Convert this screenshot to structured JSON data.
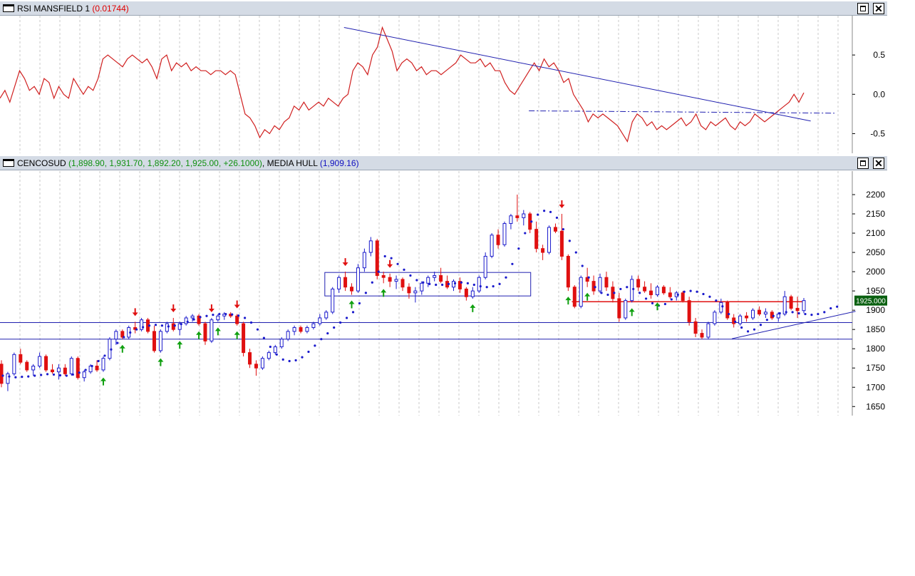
{
  "rsi_pane": {
    "title": "RSI MANSFIELD 1",
    "value": "(0.01744)"
  },
  "price_pane": {
    "symbol": "CENCOSUD",
    "ohlc": "(1,898.90, 1,931.70, 1,892.20, 1,925.00, +26.1000)",
    "indicator": "MEDIA HULL",
    "indicator_value": "(1,909.16)",
    "last_price_tag": "1925.000"
  },
  "colors": {
    "up": "#1a1acc",
    "down": "#e01010",
    "rsi_line": "#d02020",
    "trendline": "#2020b0",
    "grid": "#c8c8c8",
    "buy_arrow": "#10a010",
    "sell_arrow": "#e01010"
  },
  "icons": [
    "window-icon",
    "maximize-icon",
    "close-icon",
    "up-arrow-icon",
    "down-arrow-icon"
  ],
  "chart_data": [
    {
      "type": "line",
      "title": "RSI MANSFIELD 1",
      "ylim": [
        -0.75,
        1.0
      ],
      "yticks": [
        "0.5",
        "0.0",
        "-0.5"
      ],
      "grid": "vertical dashed",
      "series": [
        {
          "name": "RSI MANSFIELD 1",
          "values": [
            -0.05,
            0.05,
            -0.1,
            0.1,
            0.3,
            0.2,
            0.05,
            0.1,
            0.0,
            0.2,
            0.15,
            -0.05,
            0.1,
            0.0,
            -0.05,
            0.2,
            0.1,
            0.0,
            0.1,
            0.05,
            0.2,
            0.45,
            0.5,
            0.45,
            0.4,
            0.35,
            0.45,
            0.5,
            0.45,
            0.4,
            0.45,
            0.35,
            0.2,
            0.45,
            0.5,
            0.3,
            0.4,
            0.35,
            0.4,
            0.3,
            0.35,
            0.3,
            0.3,
            0.25,
            0.3,
            0.3,
            0.25,
            0.3,
            0.25,
            0.0,
            -0.25,
            -0.3,
            -0.4,
            -0.55,
            -0.45,
            -0.5,
            -0.4,
            -0.45,
            -0.35,
            -0.3,
            -0.15,
            -0.2,
            -0.1,
            -0.2,
            -0.15,
            -0.1,
            -0.15,
            -0.05,
            -0.1,
            -0.15,
            -0.05,
            0.0,
            0.3,
            0.4,
            0.35,
            0.25,
            0.5,
            0.6,
            0.85,
            0.7,
            0.55,
            0.3,
            0.4,
            0.45,
            0.4,
            0.3,
            0.35,
            0.25,
            0.3,
            0.3,
            0.25,
            0.3,
            0.35,
            0.4,
            0.5,
            0.45,
            0.4,
            0.4,
            0.45,
            0.35,
            0.4,
            0.3,
            0.3,
            0.15,
            0.05,
            0.0,
            0.1,
            0.2,
            0.3,
            0.4,
            0.3,
            0.45,
            0.35,
            0.4,
            0.3,
            0.15,
            0.2,
            0.0,
            -0.1,
            -0.2,
            -0.35,
            -0.25,
            -0.3,
            -0.25,
            -0.3,
            -0.35,
            -0.4,
            -0.5,
            -0.6,
            -0.35,
            -0.25,
            -0.3,
            -0.4,
            -0.35,
            -0.45,
            -0.4,
            -0.45,
            -0.4,
            -0.35,
            -0.3,
            -0.4,
            -0.35,
            -0.25,
            -0.4,
            -0.45,
            -0.35,
            -0.4,
            -0.35,
            -0.3,
            -0.4,
            -0.45,
            -0.35,
            -0.4,
            -0.35,
            -0.25,
            -0.3,
            -0.35,
            -0.3,
            -0.25,
            -0.2,
            -0.15,
            -0.1,
            0.0,
            -0.1,
            0.02
          ]
        }
      ],
      "trendlines": [
        {
          "style": "solid",
          "from": [
            0.376,
            0.85
          ],
          "to": [
            0.886,
            -0.34
          ]
        },
        {
          "style": "dashdot",
          "from": [
            0.578,
            -0.21
          ],
          "to": [
            0.912,
            -0.24
          ]
        }
      ]
    },
    {
      "type": "candlestick",
      "title": "CENCOSUD",
      "ylim": [
        1650,
        2220
      ],
      "yticks": [
        "2200",
        "2150",
        "2100",
        "2050",
        "2000",
        "1950",
        "1900",
        "1850",
        "1800",
        "1750",
        "1700",
        "1650"
      ],
      "grid": "vertical dashed",
      "candles": [
        [
          1760,
          1770,
          1700,
          1710
        ],
        [
          1710,
          1740,
          1690,
          1735
        ],
        [
          1735,
          1790,
          1730,
          1785
        ],
        [
          1785,
          1800,
          1760,
          1765
        ],
        [
          1765,
          1770,
          1740,
          1745
        ],
        [
          1745,
          1760,
          1730,
          1755
        ],
        [
          1755,
          1790,
          1750,
          1780
        ],
        [
          1780,
          1785,
          1740,
          1745
        ],
        [
          1745,
          1760,
          1735,
          1740
        ],
        [
          1740,
          1760,
          1720,
          1750
        ],
        [
          1750,
          1760,
          1730,
          1735
        ],
        [
          1735,
          1780,
          1730,
          1775
        ],
        [
          1775,
          1780,
          1720,
          1725
        ],
        [
          1725,
          1745,
          1715,
          1740
        ],
        [
          1740,
          1760,
          1735,
          1755
        ],
        [
          1755,
          1770,
          1740,
          1745
        ],
        [
          1745,
          1780,
          1740,
          1775
        ],
        [
          1775,
          1830,
          1770,
          1825
        ],
        [
          1825,
          1850,
          1810,
          1845
        ],
        [
          1845,
          1850,
          1825,
          1830
        ],
        [
          1830,
          1860,
          1825,
          1855
        ],
        [
          1855,
          1870,
          1840,
          1850
        ],
        [
          1850,
          1880,
          1845,
          1875
        ],
        [
          1875,
          1880,
          1840,
          1845
        ],
        [
          1845,
          1860,
          1790,
          1795
        ],
        [
          1795,
          1850,
          1790,
          1845
        ],
        [
          1845,
          1870,
          1840,
          1865
        ],
        [
          1865,
          1880,
          1845,
          1850
        ],
        [
          1850,
          1870,
          1835,
          1865
        ],
        [
          1865,
          1885,
          1860,
          1880
        ],
        [
          1880,
          1890,
          1870,
          1885
        ],
        [
          1885,
          1890,
          1860,
          1865
        ],
        [
          1865,
          1870,
          1810,
          1820
        ],
        [
          1820,
          1880,
          1815,
          1875
        ],
        [
          1875,
          1890,
          1870,
          1885
        ],
        [
          1885,
          1895,
          1875,
          1890
        ],
        [
          1890,
          1895,
          1880,
          1885
        ],
        [
          1885,
          1890,
          1860,
          1865
        ],
        [
          1865,
          1870,
          1780,
          1790
        ],
        [
          1790,
          1800,
          1750,
          1760
        ],
        [
          1760,
          1770,
          1730,
          1750
        ],
        [
          1750,
          1780,
          1745,
          1775
        ],
        [
          1775,
          1795,
          1770,
          1790
        ],
        [
          1790,
          1810,
          1785,
          1805
        ],
        [
          1805,
          1830,
          1800,
          1825
        ],
        [
          1825,
          1850,
          1820,
          1845
        ],
        [
          1845,
          1860,
          1835,
          1855
        ],
        [
          1855,
          1860,
          1840,
          1845
        ],
        [
          1845,
          1860,
          1840,
          1855
        ],
        [
          1855,
          1870,
          1850,
          1865
        ],
        [
          1865,
          1890,
          1860,
          1880
        ],
        [
          1880,
          1900,
          1875,
          1895
        ],
        [
          1895,
          1960,
          1890,
          1955
        ],
        [
          1955,
          1990,
          1945,
          1985
        ],
        [
          1985,
          2000,
          1950,
          1960
        ],
        [
          1960,
          1970,
          1940,
          1950
        ],
        [
          1950,
          2020,
          1945,
          2010
        ],
        [
          2010,
          2060,
          2000,
          2050
        ],
        [
          2050,
          2090,
          2040,
          2080
        ],
        [
          2080,
          2085,
          1980,
          1990
        ],
        [
          1990,
          2000,
          1970,
          1985
        ],
        [
          1985,
          1995,
          1960,
          1975
        ],
        [
          1975,
          1990,
          1955,
          1980
        ],
        [
          1980,
          1985,
          1950,
          1960
        ],
        [
          1960,
          1970,
          1930,
          1945
        ],
        [
          1945,
          1960,
          1920,
          1950
        ],
        [
          1950,
          1975,
          1940,
          1970
        ],
        [
          1970,
          1990,
          1960,
          1985
        ],
        [
          1985,
          2000,
          1975,
          1990
        ],
        [
          1990,
          2010,
          1970,
          1975
        ],
        [
          1975,
          1990,
          1955,
          1960
        ],
        [
          1960,
          1980,
          1950,
          1975
        ],
        [
          1975,
          1985,
          1945,
          1955
        ],
        [
          1955,
          1960,
          1925,
          1935
        ],
        [
          1935,
          1960,
          1930,
          1950
        ],
        [
          1950,
          1990,
          1945,
          1985
        ],
        [
          1985,
          2050,
          1980,
          2040
        ],
        [
          2040,
          2100,
          2035,
          2095
        ],
        [
          2095,
          2110,
          2060,
          2070
        ],
        [
          2070,
          2130,
          2065,
          2125
        ],
        [
          2125,
          2150,
          2110,
          2145
        ],
        [
          2145,
          2200,
          2130,
          2140
        ],
        [
          2140,
          2160,
          2120,
          2150
        ],
        [
          2150,
          2155,
          2100,
          2110
        ],
        [
          2110,
          2130,
          2050,
          2060
        ],
        [
          2060,
          2070,
          2030,
          2050
        ],
        [
          2050,
          2120,
          2045,
          2115
        ],
        [
          2115,
          2125,
          2100,
          2105
        ],
        [
          2105,
          2150,
          2030,
          2040
        ],
        [
          2040,
          2045,
          1950,
          1960
        ],
        [
          1960,
          1965,
          1905,
          1910
        ],
        [
          1910,
          1990,
          1905,
          1985
        ],
        [
          1985,
          2010,
          1960,
          1975
        ],
        [
          1975,
          1990,
          1940,
          1950
        ],
        [
          1950,
          1995,
          1945,
          1985
        ],
        [
          1985,
          2000,
          1950,
          1960
        ],
        [
          1960,
          1975,
          1920,
          1930
        ],
        [
          1930,
          1945,
          1870,
          1880
        ],
        [
          1880,
          1930,
          1875,
          1925
        ],
        [
          1925,
          1990,
          1920,
          1980
        ],
        [
          1980,
          1990,
          1950,
          1960
        ],
        [
          1960,
          1975,
          1945,
          1950
        ],
        [
          1950,
          1970,
          1930,
          1940
        ],
        [
          1940,
          1965,
          1935,
          1960
        ],
        [
          1960,
          1965,
          1940,
          1945
        ],
        [
          1945,
          1960,
          1930,
          1935
        ],
        [
          1935,
          1950,
          1925,
          1945
        ],
        [
          1945,
          1950,
          1920,
          1925
        ],
        [
          1925,
          1935,
          1860,
          1870
        ],
        [
          1870,
          1880,
          1830,
          1840
        ],
        [
          1840,
          1850,
          1825,
          1830
        ],
        [
          1830,
          1870,
          1825,
          1865
        ],
        [
          1865,
          1900,
          1860,
          1895
        ],
        [
          1895,
          1930,
          1890,
          1920
        ],
        [
          1920,
          1925,
          1875,
          1880
        ],
        [
          1880,
          1890,
          1855,
          1865
        ],
        [
          1865,
          1890,
          1860,
          1885
        ],
        [
          1885,
          1895,
          1870,
          1880
        ],
        [
          1880,
          1905,
          1875,
          1900
        ],
        [
          1900,
          1910,
          1885,
          1890
        ],
        [
          1890,
          1905,
          1880,
          1895
        ],
        [
          1895,
          1900,
          1875,
          1880
        ],
        [
          1880,
          1895,
          1870,
          1890
        ],
        [
          1890,
          1950,
          1885,
          1935
        ],
        [
          1935,
          1940,
          1900,
          1905
        ],
        [
          1905,
          1935,
          1880,
          1898.9
        ],
        [
          1898.9,
          1931.7,
          1892.2,
          1925.0
        ]
      ],
      "hull_ma": [
        1730,
        1728,
        1726,
        1727,
        1728,
        1730,
        1732,
        1734,
        1733,
        1731,
        1730,
        1733,
        1738,
        1745,
        1755,
        1768,
        1782,
        1798,
        1815,
        1830,
        1842,
        1850,
        1856,
        1860,
        1862,
        1860,
        1858,
        1860,
        1864,
        1870,
        1876,
        1882,
        1885,
        1888,
        1890,
        1890,
        1889,
        1886,
        1880,
        1868,
        1850,
        1828,
        1805,
        1785,
        1772,
        1768,
        1770,
        1778,
        1792,
        1808,
        1825,
        1840,
        1855,
        1868,
        1880,
        1895,
        1918,
        1945,
        1972,
        2000,
        2040,
        2035,
        2020,
        2005,
        1990,
        1978,
        1972,
        1968,
        1966,
        1966,
        1968,
        1970,
        1972,
        1970,
        1966,
        1962,
        1960,
        1962,
        1968,
        1985,
        2020,
        2060,
        2100,
        2130,
        2148,
        2158,
        2155,
        2140,
        2110,
        2080,
        2050,
        2015,
        1985,
        1960,
        1945,
        1940,
        1945,
        1955,
        1960,
        1955,
        1945,
        1930,
        1918,
        1912,
        1916,
        1928,
        1940,
        1948,
        1950,
        1948,
        1942,
        1935,
        1925,
        1910,
        1890,
        1870,
        1855,
        1845,
        1850,
        1862,
        1875,
        1885,
        1892,
        1895,
        1895,
        1892,
        1890,
        1888,
        1890,
        1895,
        1905,
        1909.16
      ],
      "buy_signals": [
        16,
        19,
        25,
        28,
        31,
        34,
        37,
        55,
        60,
        74,
        89,
        92,
        99,
        103
      ],
      "sell_signals": [
        21,
        27,
        33,
        37,
        54,
        61,
        88
      ],
      "horizontal_lines": [
        {
          "value": 1868,
          "color": "blue"
        },
        {
          "value": 1825,
          "color": "blue"
        },
        {
          "value": 1922,
          "color": "red",
          "from": 0.625
        }
      ],
      "rectangle": {
        "x_from": 0.355,
        "x_to": 0.58,
        "y_from": 1937,
        "y_to": 1998
      },
      "support_line": {
        "from": [
          0.8,
          1826
        ],
        "to": [
          0.935,
          1897
        ]
      }
    }
  ]
}
